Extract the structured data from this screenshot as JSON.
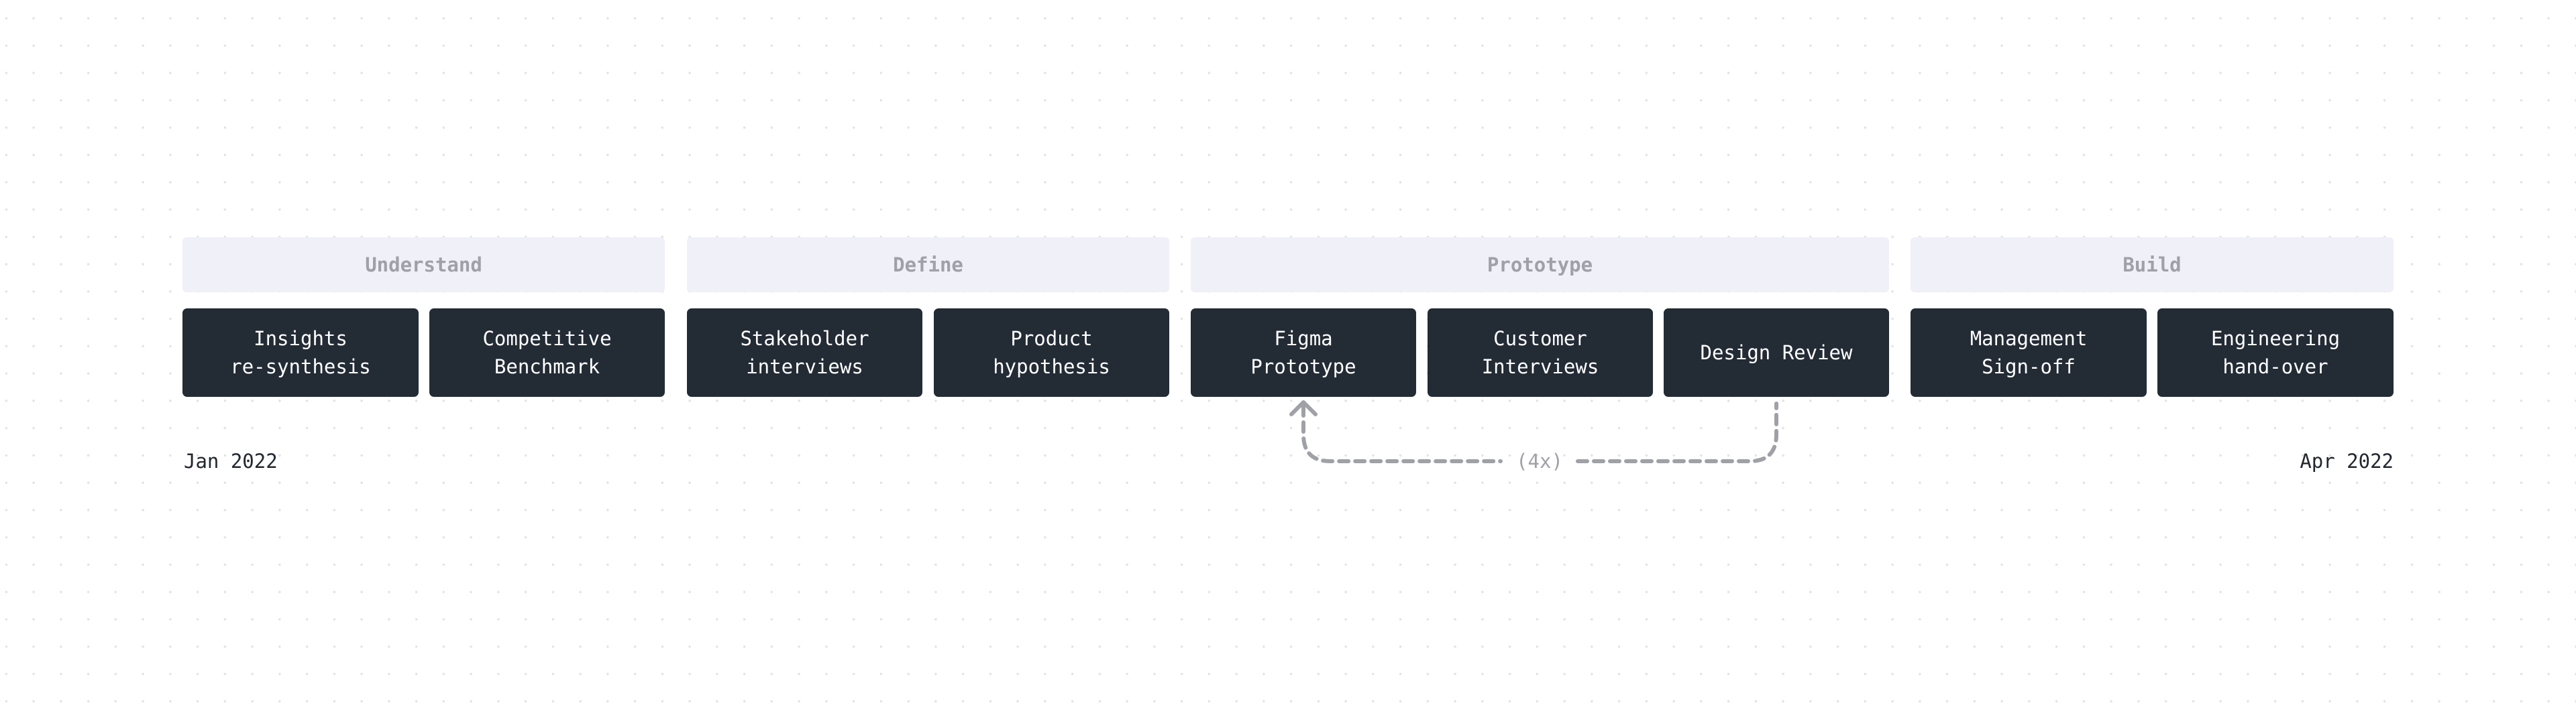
{
  "phases": [
    {
      "label": "Understand",
      "steps": [
        "Insights\nre-synthesis",
        "Competitive\nBenchmark"
      ]
    },
    {
      "label": "Define",
      "steps": [
        "Stakeholder\ninterviews",
        "Product\nhypothesis"
      ]
    },
    {
      "label": "Prototype",
      "steps": [
        "Figma\nPrototype",
        "Customer\nInterviews",
        "Design Review"
      ]
    },
    {
      "label": "Build",
      "steps": [
        "Management\nSign-off",
        "Engineering\nhand-over"
      ]
    }
  ],
  "timeline": {
    "start": "Jan 2022",
    "end": "Apr 2022"
  },
  "loop": {
    "from": "Design Review",
    "to": "Figma Prototype",
    "label": "(4x)"
  },
  "colors": {
    "card_bg": "#232b35",
    "header_bg": "#eff0f8",
    "header_text": "#a0a1a8",
    "loop_stroke": "#a0a1a6"
  }
}
